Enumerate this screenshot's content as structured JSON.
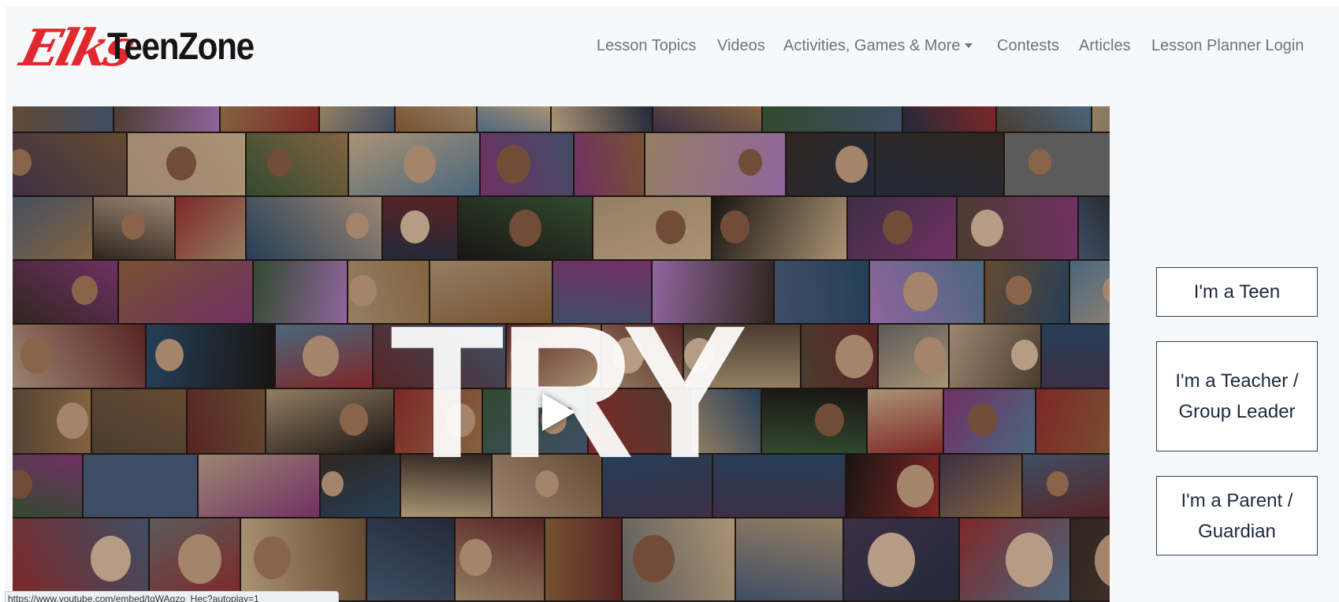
{
  "brand": {
    "logo_script": "Elks",
    "logo_text": "TeenZone",
    "logo_color": "#e0282e"
  },
  "nav": {
    "items": [
      {
        "label": "Lesson Topics"
      },
      {
        "label": "Videos"
      },
      {
        "label": "Activities, Games & More",
        "dropdown": true
      },
      {
        "label": "Contests"
      },
      {
        "label": "Articles"
      },
      {
        "label": "Lesson Planner Login"
      }
    ]
  },
  "video": {
    "overlay_text": "TRY",
    "play_icon": "play-icon",
    "status_url": "https://www.youtube.com/embed/tqWAgzo_Hec?autoplay=1"
  },
  "roles": [
    {
      "label": "I'm a Teen"
    },
    {
      "label": "I'm a Teacher / Group Leader"
    },
    {
      "label": "I'm a Parent / Guardian"
    }
  ],
  "colors": {
    "nav_text": "#6c757d",
    "button_border": "#263d5c",
    "button_text": "#1b2a3e",
    "page_background": "#f7f8fa"
  }
}
